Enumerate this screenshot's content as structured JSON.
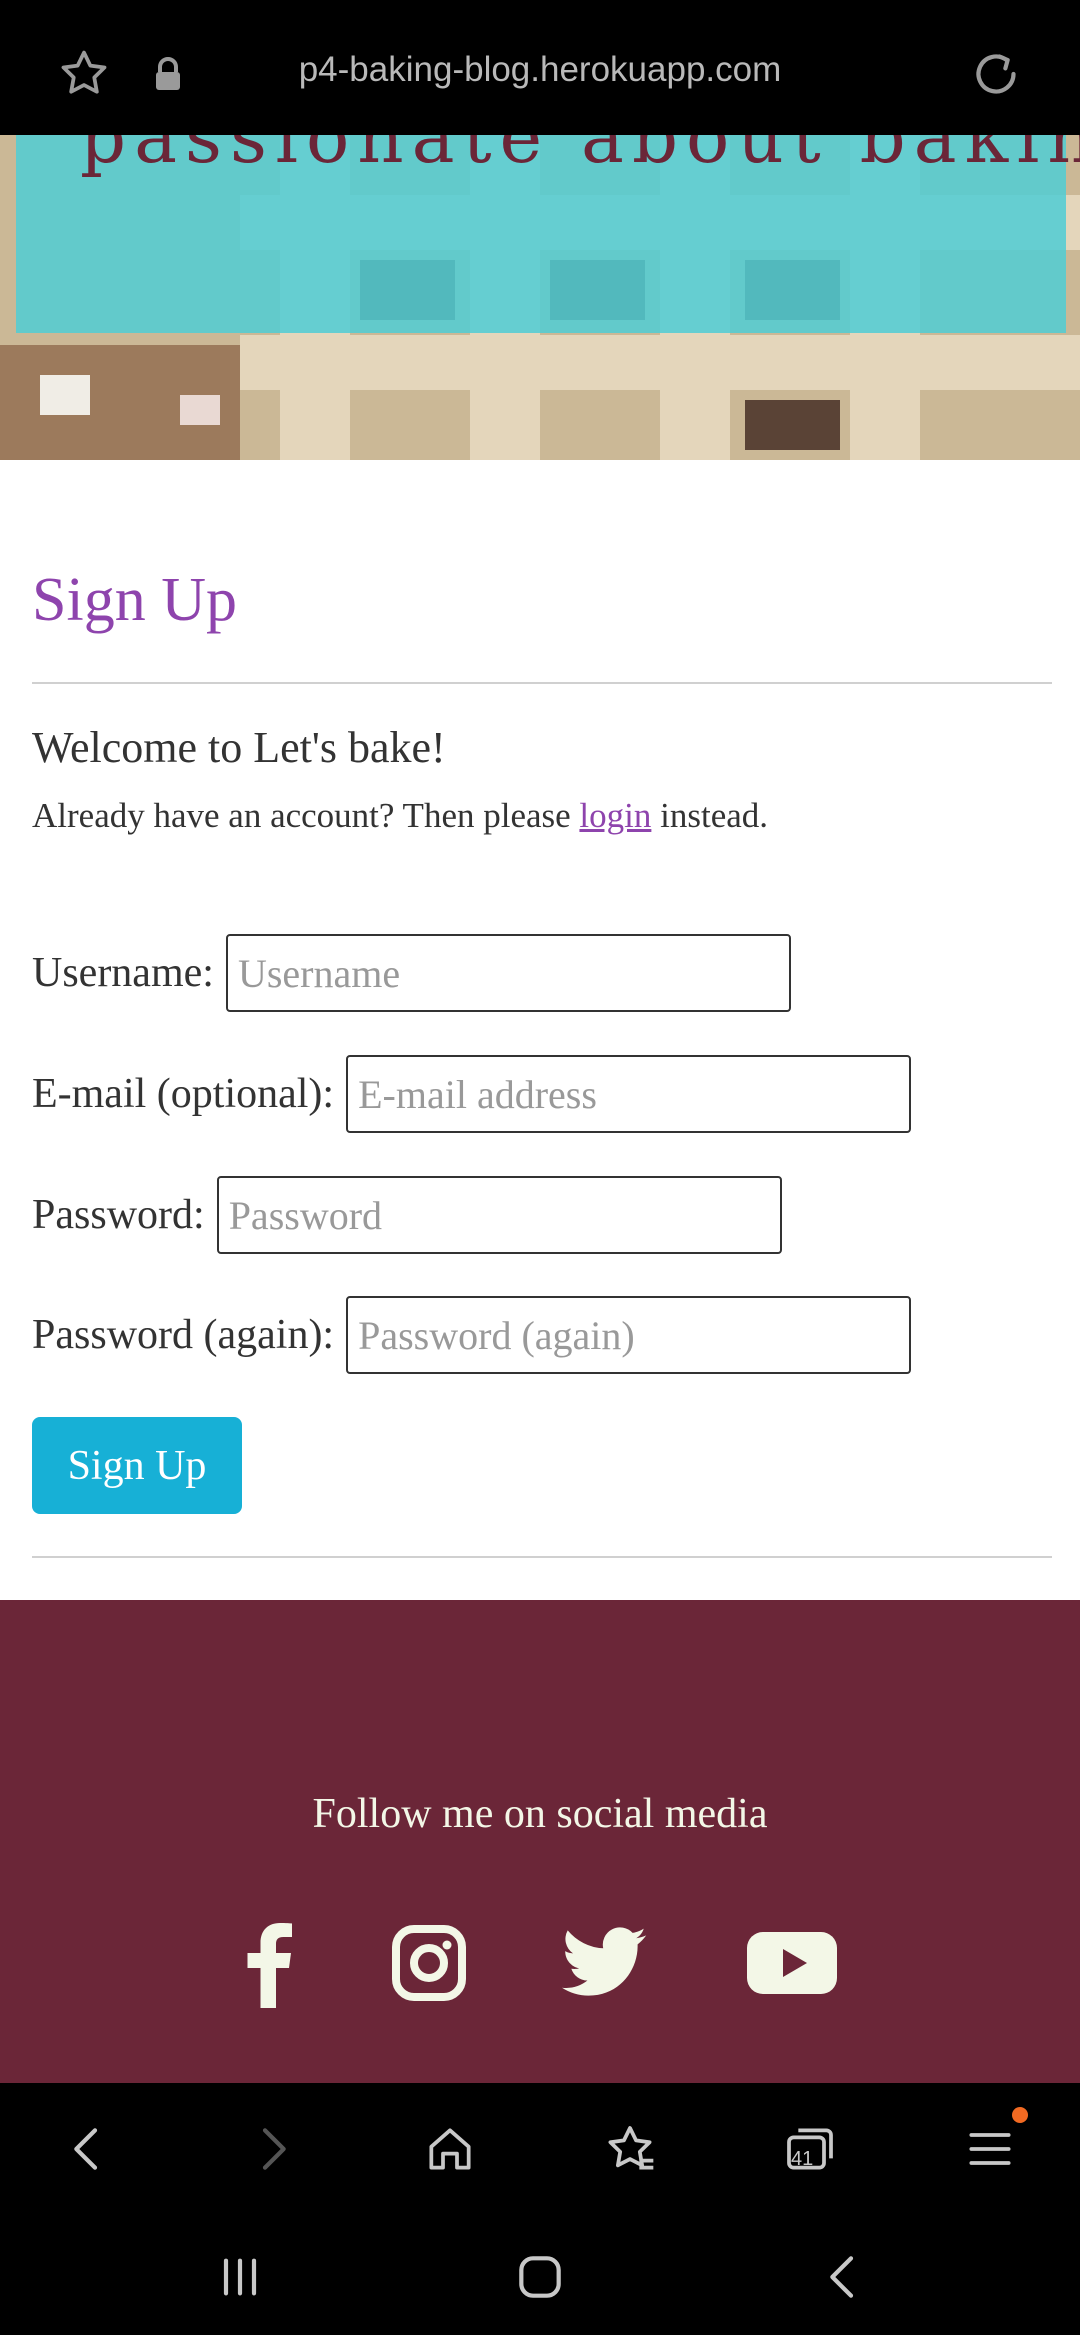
{
  "browser": {
    "url": "p4-baking-blog.herokuapp.com",
    "tab_count": "41"
  },
  "hero": {
    "tagline": "passionate about baking"
  },
  "signup": {
    "title": "Sign Up",
    "welcome": "Welcome to Let's bake!",
    "already_prefix": "Already have an account? Then please ",
    "login_link": "login",
    "already_suffix": " instead.",
    "fields": [
      {
        "label": "Username:",
        "placeholder": "Username",
        "value": ""
      },
      {
        "label": "E-mail (optional):",
        "placeholder": "E-mail address",
        "value": ""
      },
      {
        "label": "Password:",
        "placeholder": "Password",
        "value": ""
      },
      {
        "label": "Password (again):",
        "placeholder": "Password (again)",
        "value": ""
      }
    ],
    "submit_label": "Sign Up"
  },
  "footer": {
    "follow_text": "Follow me on social media",
    "social": [
      "facebook-icon",
      "instagram-icon",
      "twitter-icon",
      "youtube-icon"
    ]
  },
  "colors": {
    "accent_purple": "#8e44ad",
    "button": "#17b0d6",
    "footer_bg": "#6b2638",
    "footer_text": "#f3f7e7",
    "hero_overlay": "#50cdd4"
  }
}
